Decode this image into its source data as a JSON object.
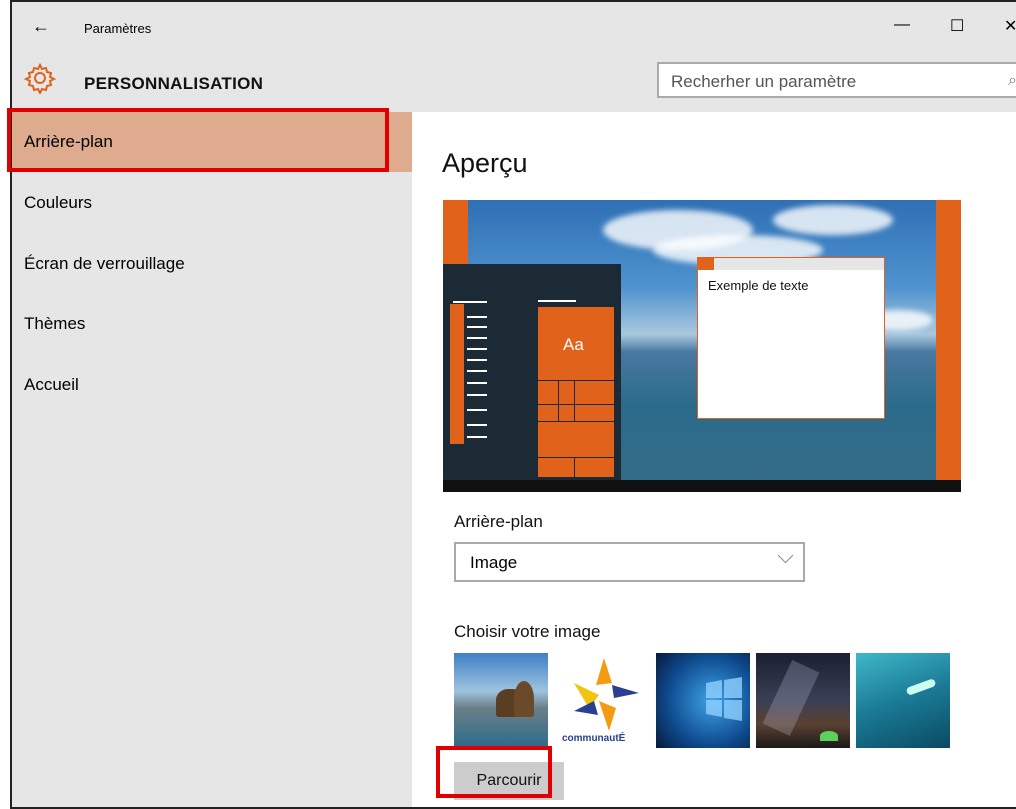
{
  "window": {
    "title": "Paramètres",
    "back_icon": "back-arrow-icon",
    "minimize": "—",
    "maximize": "☐",
    "close": "✕"
  },
  "header": {
    "title": "PERSONNALISATION",
    "search_placeholder": "Recherher un paramètre"
  },
  "sidebar": {
    "items": [
      {
        "label": "Arrière-plan",
        "active": true
      },
      {
        "label": "Couleurs",
        "active": false
      },
      {
        "label": "Écran de verrouillage",
        "active": false
      },
      {
        "label": "Thèmes",
        "active": false
      },
      {
        "label": "Accueil",
        "active": false
      }
    ]
  },
  "main": {
    "preview_title": "Aperçu",
    "preview_tile_text": "Aa",
    "preview_window_text": "Exemple de texte",
    "background_label": "Arrière-plan",
    "background_value": "Image",
    "choose_image_label": "Choisir votre image",
    "thumbnails": [
      {
        "name": "beach-rocks",
        "caption": ""
      },
      {
        "name": "communaute-logo",
        "caption": "communautÉ"
      },
      {
        "name": "windows-logo",
        "caption": ""
      },
      {
        "name": "night-sky",
        "caption": ""
      },
      {
        "name": "underwater-swimmer",
        "caption": ""
      }
    ],
    "browse_label": "Parcourir"
  },
  "colors": {
    "accent": "#e0621b",
    "highlight": "#e00000",
    "sidebar_active": "#dfab8f",
    "chrome": "#e6e6e6"
  }
}
